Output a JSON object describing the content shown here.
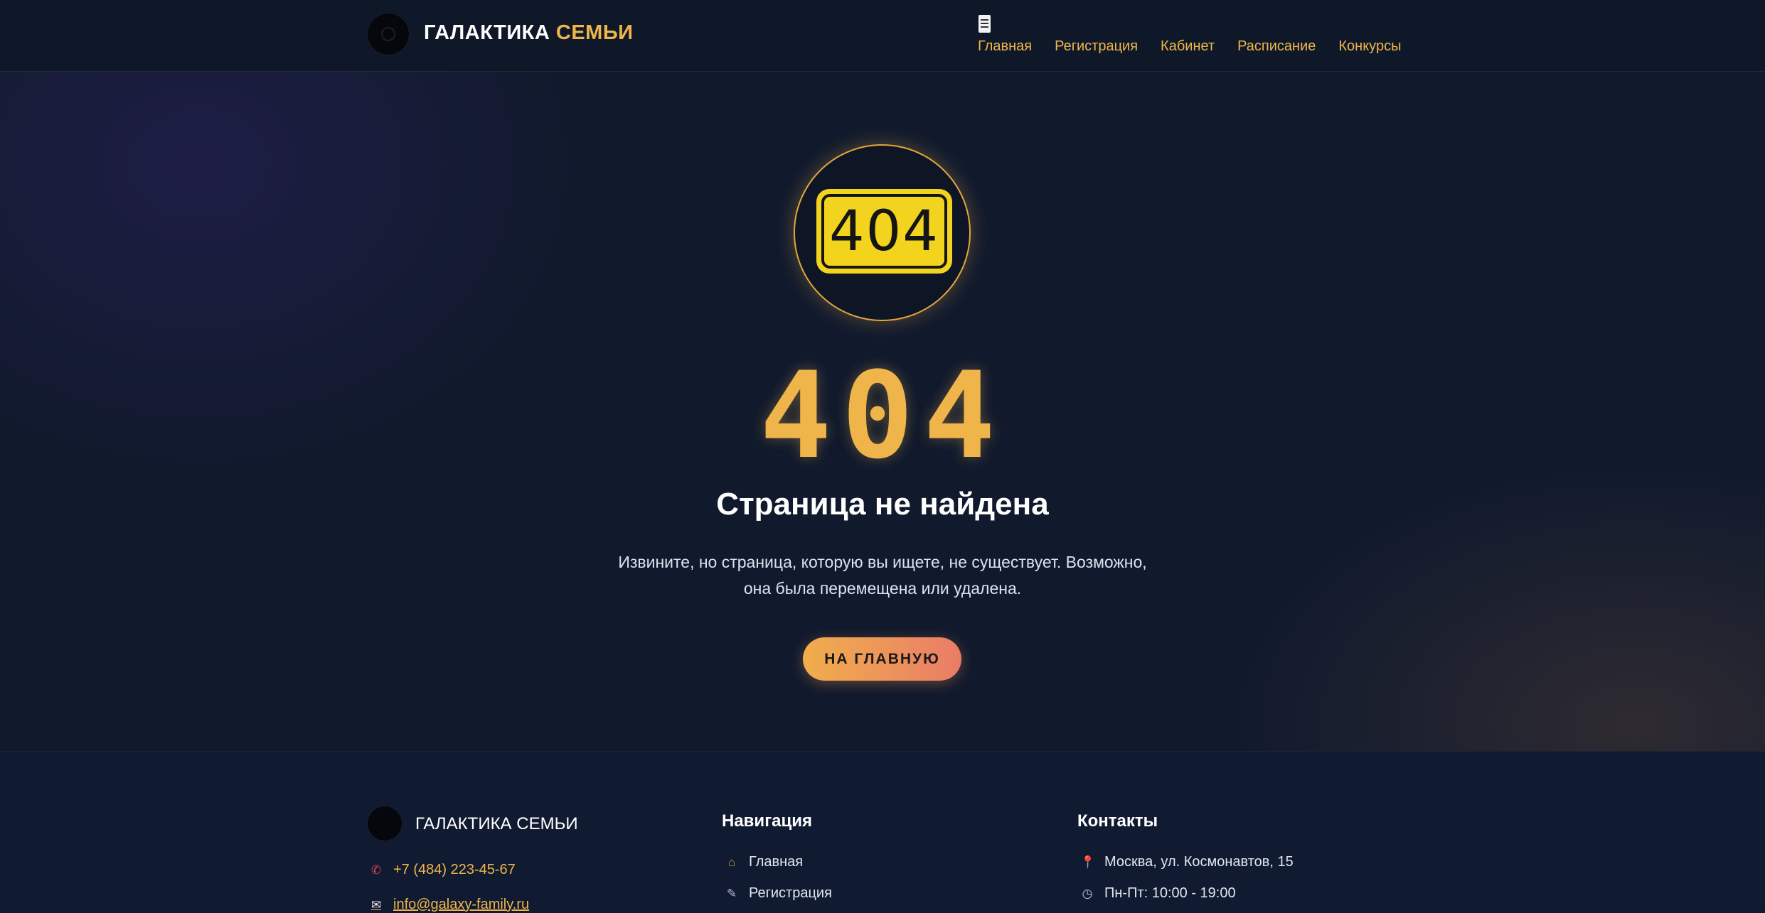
{
  "header": {
    "brand_main": "ГАЛАКТИКА",
    "brand_accent": "СЕМЬИ",
    "nav": [
      {
        "label": "Главная"
      },
      {
        "label": "Регистрация"
      },
      {
        "label": "Кабинет"
      },
      {
        "label": "Расписание"
      },
      {
        "label": "Конкурсы"
      }
    ]
  },
  "hero": {
    "badge_code": "404",
    "code": "404",
    "title": "Страница не найдена",
    "text_line1": "Извините, но страница, которую вы ищете, не существует. Возможно,",
    "text_line2": "она была перемещена или удалена.",
    "button_label": "НА ГЛАВНУЮ"
  },
  "footer": {
    "brand": "ГАЛАКТИКА СЕМЬИ",
    "phone": "+7 (484) 223-45-67",
    "email": "info@galaxy-family.ru",
    "nav_heading": "Навигация",
    "nav_items": [
      {
        "label": "Главная",
        "icon": "house-icon"
      },
      {
        "label": "Регистрация",
        "icon": "memo-icon"
      }
    ],
    "contacts_heading": "Контакты",
    "address": "Москва, ул. Космонавтов, 15",
    "hours": "Пн-Пт: 10:00 - 19:00"
  },
  "colors": {
    "accent": "#efb54a",
    "background": "#111a2d",
    "button_gradient_start": "#f0ae4c",
    "button_gradient_end": "#ea7c67"
  }
}
